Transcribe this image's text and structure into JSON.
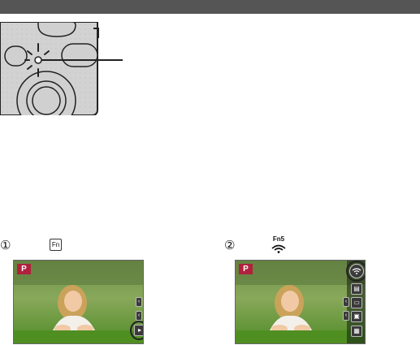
{
  "steps": [
    {
      "number": "①",
      "icon": "fn-button-icon",
      "icon_text": "Fn"
    },
    {
      "number": "②",
      "icon": "fn5-wifi-icon",
      "icon_text": "Fn5"
    }
  ],
  "screens": [
    {
      "mode_badge": "P",
      "highlight": "fn-tab"
    },
    {
      "mode_badge": "P",
      "highlight": "wifi-fn5-tab"
    }
  ],
  "colors": {
    "header": "#555555",
    "mode_badge": "#b0213d",
    "grass": "#5f9a2d",
    "camera_body": "#cfcfcf"
  }
}
